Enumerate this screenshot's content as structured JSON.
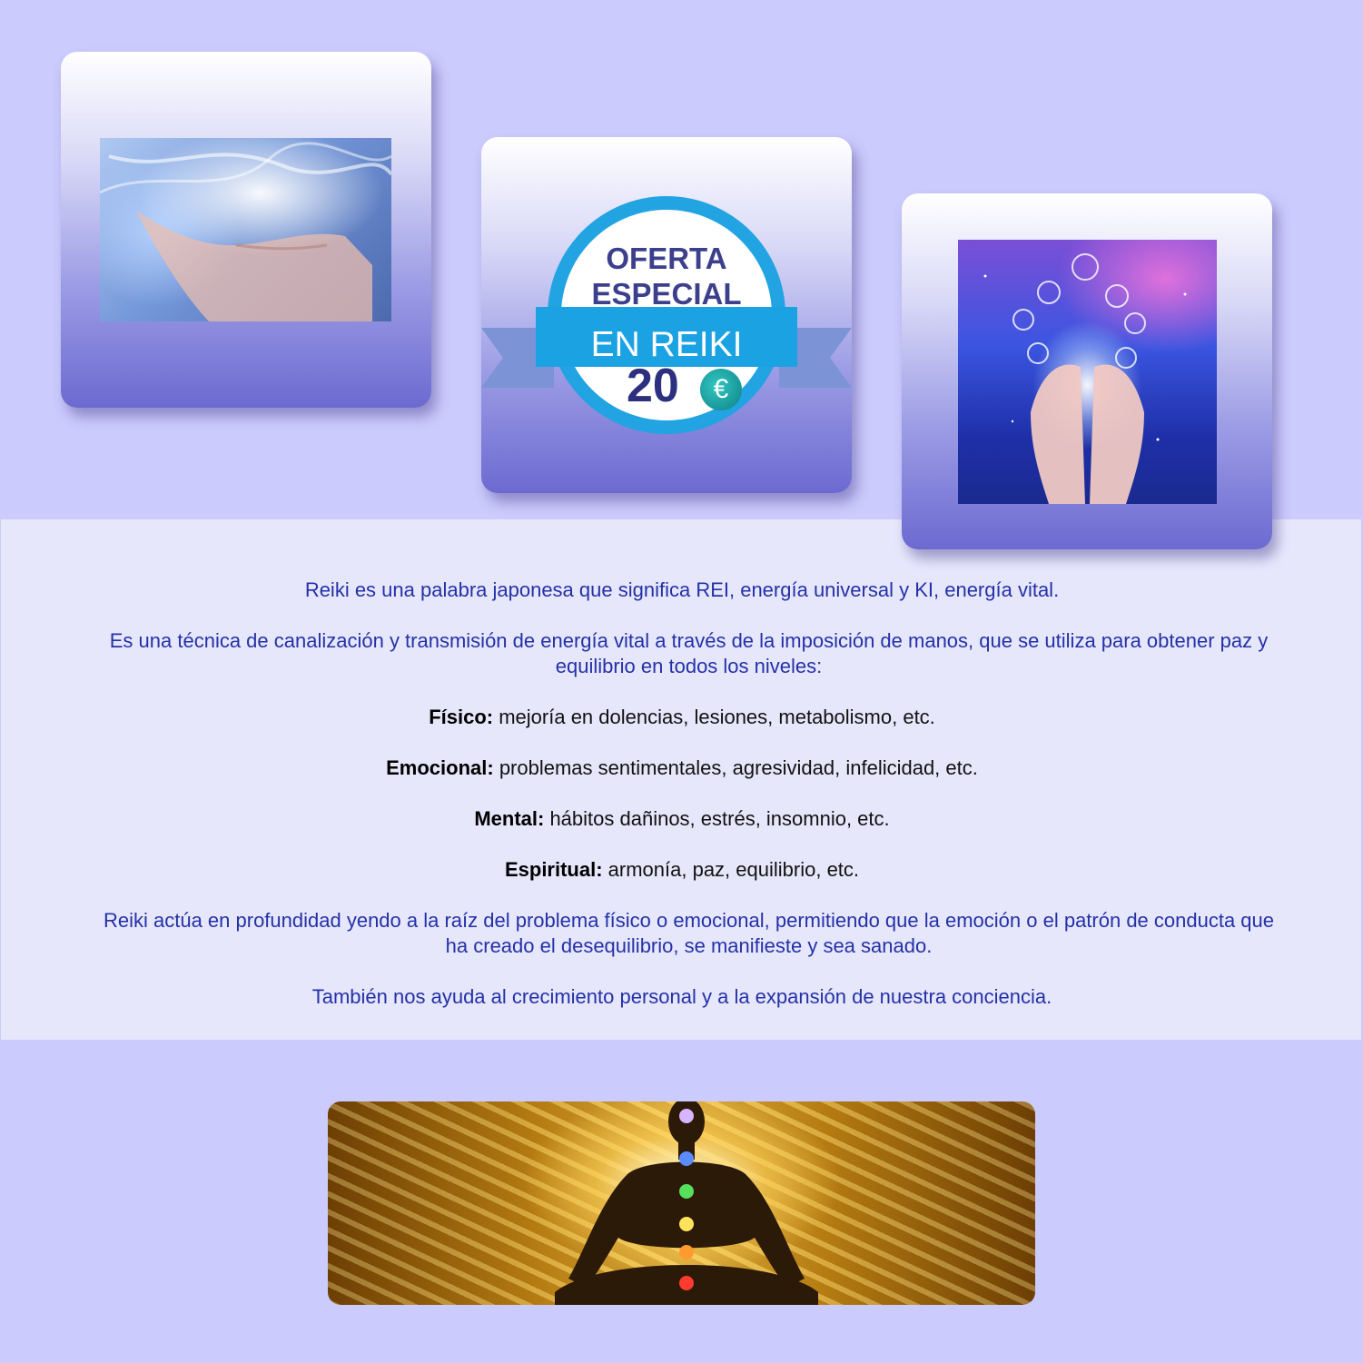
{
  "badge": {
    "line1": "OFERTA",
    "line2": "ESPECIAL",
    "line3": "EN REIKI",
    "price": "20",
    "currency": "€"
  },
  "content": {
    "intro": "Reiki es una palabra japonesa que significa REI, energía universal y KI, energía vital.",
    "technique": "Es una técnica de canalización y transmisión de energía vital a través de la imposición de manos, que se utiliza para obtener paz y equilibrio en todos los niveles:",
    "levels": [
      {
        "label": "Físico:",
        "text": " mejoría en dolencias, lesiones, metabolismo, etc."
      },
      {
        "label": "Emocional:",
        "text": " problemas sentimentales, agresividad, infelicidad, etc."
      },
      {
        "label": "Mental:",
        "text": " hábitos dañinos, estrés, insomnio, etc."
      },
      {
        "label": "Espiritual:",
        "text": " armonía, paz, equilibrio, etc."
      }
    ],
    "depth": "Reiki actúa en profundidad yendo a la raíz del problema físico o emocional, permitiendo que la emoción o el patrón de conducta que ha creado el desequilibrio, se manifieste y sea sanado.",
    "growth": "También nos ayuda al crecimiento personal y a la expansión de nuestra conciencia."
  },
  "colors": {
    "background": "#cbcbfd",
    "panel": "#e7e7fc",
    "text_blue": "#2431a7",
    "badge_blue": "#22a3e2"
  }
}
